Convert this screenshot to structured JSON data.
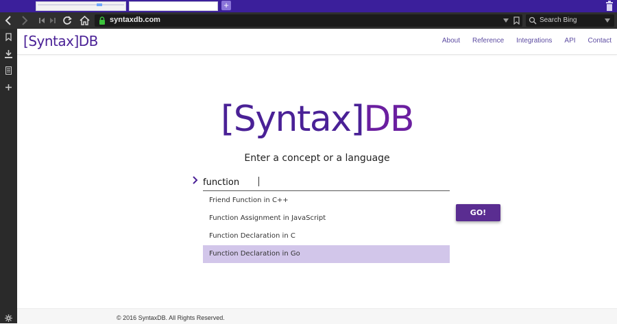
{
  "browser": {
    "url": "syntaxdb.com",
    "search_placeholder": "Search Bing",
    "new_tab_label": "+"
  },
  "site": {
    "logo_bracket_open": "[",
    "logo_syntax": "Syntax",
    "logo_bracket_close": "]",
    "logo_db": "DB",
    "nav": [
      "About",
      "Reference",
      "Integrations",
      "API",
      "Contact"
    ]
  },
  "hero": {
    "subtitle": "Enter a concept or a language",
    "search_value": "function",
    "suggestions": [
      "Friend Function in C++",
      "Function Assignment in JavaScript",
      "Function Declaration in C",
      "Function Declaration in Go"
    ],
    "active_suggestion": "Function Declaration in Go",
    "go_label": "GO!"
  },
  "footer": {
    "copyright": "© 2016 SyntaxDB. All Rights Reserved."
  },
  "colors": {
    "accent": "#5a2d91",
    "logo": "#4a2196",
    "tabbar": "#3b1f9b",
    "suggestion_highlight": "#d2c6ea"
  },
  "icons": [
    "back-icon",
    "forward-icon",
    "rewind-icon",
    "fast-forward-icon",
    "reload-icon",
    "home-icon",
    "lock-icon",
    "bookmark-icon",
    "download-icon",
    "notes-icon",
    "add-panel-icon",
    "settings-icon",
    "trash-icon",
    "chevron-right-icon"
  ]
}
